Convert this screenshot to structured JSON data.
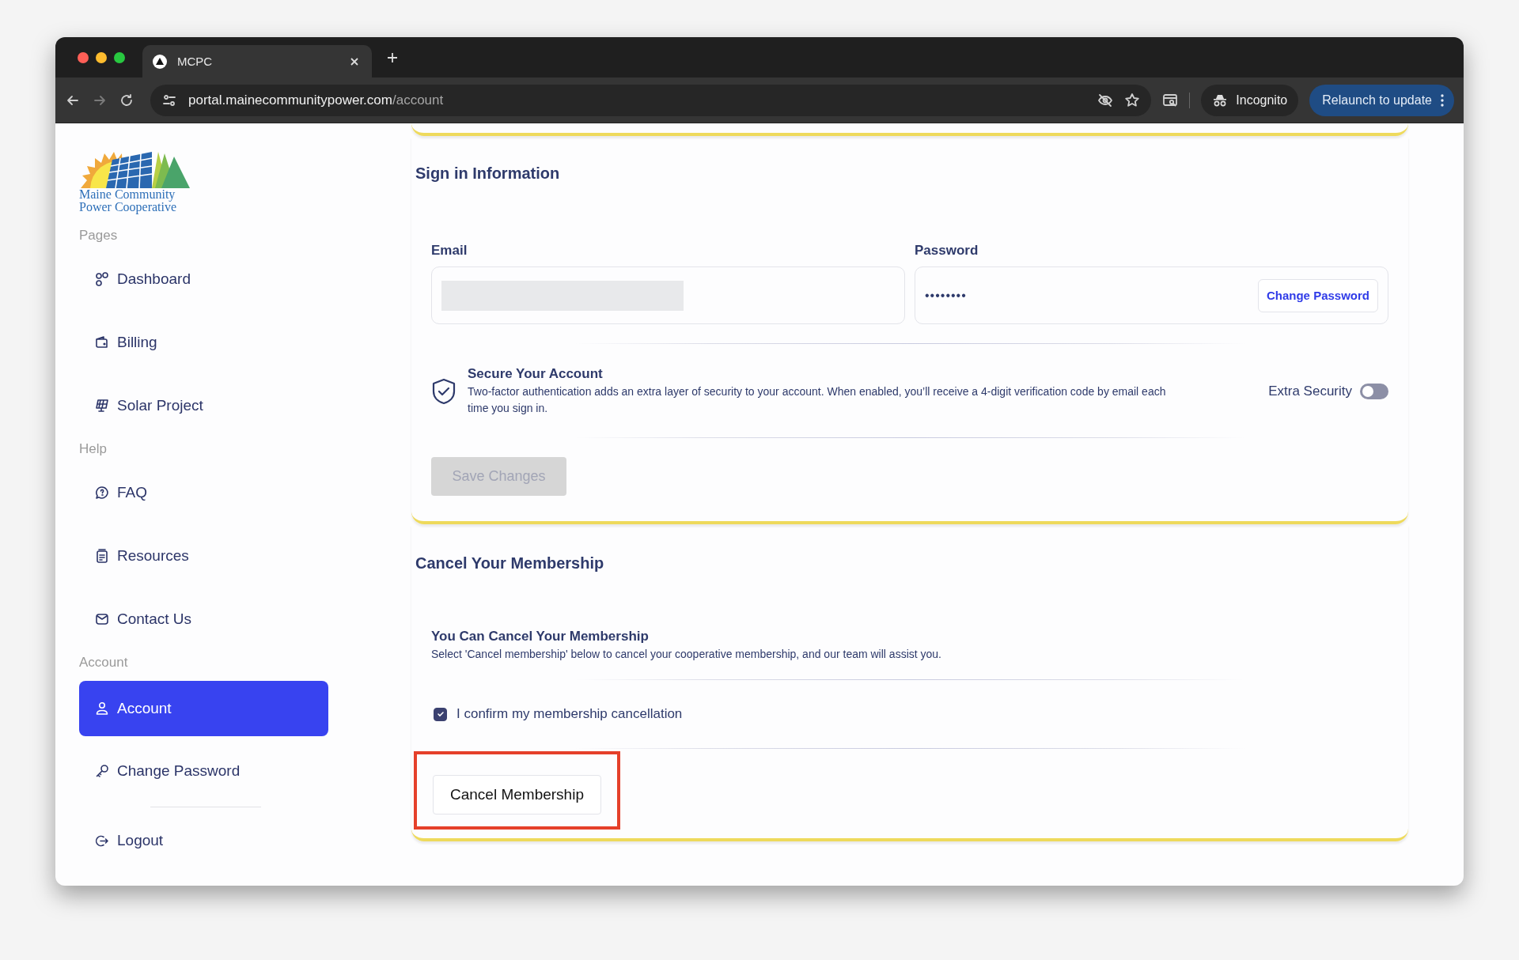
{
  "browser": {
    "tab": {
      "title": "MCPC"
    },
    "address": {
      "host": "portal.mainecommunitypower.com",
      "path": "/account"
    },
    "profile": "Incognito",
    "update_button": "Relaunch to update"
  },
  "sidebar": {
    "logo": {
      "line_1": "Maine Community",
      "line_2": "Power Cooperative"
    },
    "sections": [
      {
        "label": "Pages",
        "items": [
          {
            "label": "Dashboard",
            "kind": "dashboard",
            "selected": false
          },
          {
            "label": "Billing",
            "kind": "billing",
            "selected": false
          },
          {
            "label": "Solar Project",
            "kind": "solar",
            "selected": false
          }
        ]
      },
      {
        "label": "Help",
        "items": [
          {
            "label": "FAQ",
            "kind": "faq",
            "selected": false
          },
          {
            "label": "Resources",
            "kind": "resources",
            "selected": false
          },
          {
            "label": "Contact Us",
            "kind": "contact",
            "selected": false
          }
        ]
      },
      {
        "label": "Account",
        "items": [
          {
            "label": "Account",
            "kind": "account",
            "selected": true
          },
          {
            "label": "Change Password",
            "kind": "password",
            "selected": false
          }
        ]
      }
    ],
    "logout": {
      "label": "Logout"
    }
  },
  "sign_in": {
    "title": "Sign in Information",
    "email": {
      "label": "Email",
      "redacted": true
    },
    "password": {
      "label": "Password",
      "value": "••••••••",
      "button": "Change Password"
    },
    "security": {
      "title": "Secure Your Account",
      "text": "Two-factor authentication adds an extra layer of security to your account. When enabled, you’ll receive a 4-digit verification code by email each time you sign in.",
      "toggle_label": "Extra Security",
      "on": false
    },
    "save_button": {
      "label": "Save Changes",
      "disabled": true
    }
  },
  "cancel": {
    "title": "Cancel Your Membership",
    "subtitle": "You Can Cancel Your Membership",
    "text": "Select 'Cancel membership' below to cancel your cooperative membership, and our team will assist you.",
    "confirm": {
      "label": "I confirm my membership cancellation",
      "checked": true
    },
    "button": {
      "label": "Cancel Membership",
      "highlighted": true
    }
  }
}
